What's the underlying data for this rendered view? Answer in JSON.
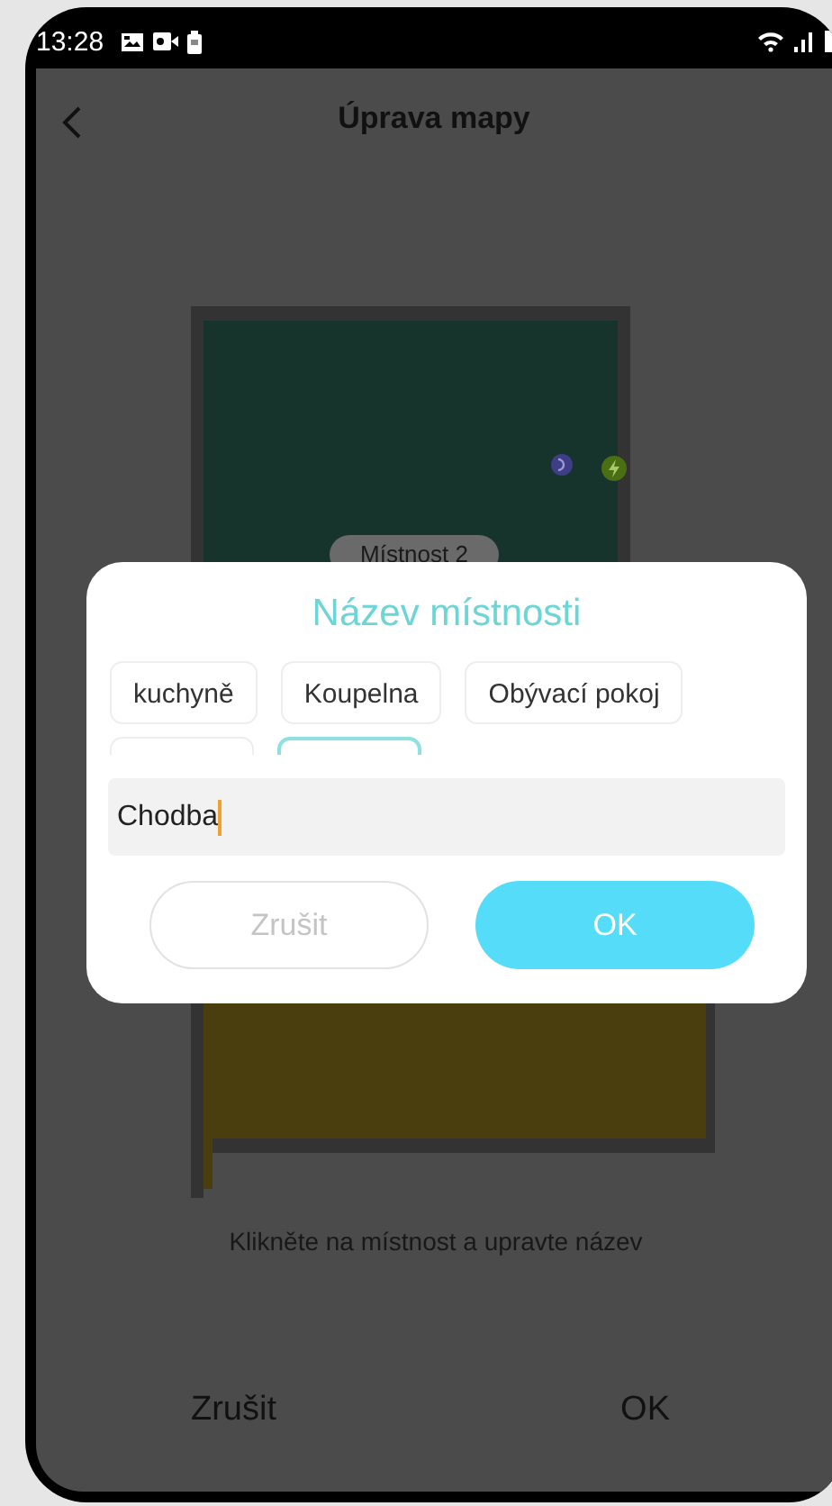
{
  "status_bar": {
    "time": "13:28"
  },
  "header": {
    "title": "Úprava mapy"
  },
  "map": {
    "room_labels": [
      {
        "label": "Místnost 2"
      }
    ]
  },
  "hint": "Klikněte na místnost a upravte název",
  "bottom_actions": [
    {
      "label": "Zrušit"
    },
    {
      "label": "OK"
    }
  ],
  "dialog": {
    "title": "Název místnosti",
    "room_chips": [
      {
        "label": "kuchyně",
        "selected": false
      },
      {
        "label": "Koupelna",
        "selected": false
      },
      {
        "label": "Obývací pokoj",
        "selected": false
      },
      {
        "selected": false
      },
      {
        "selected": true
      }
    ],
    "name_field": {
      "value": "Chodba"
    },
    "buttons": [
      {
        "label": "Zrušit",
        "kind": "cancel"
      },
      {
        "label": "OK",
        "kind": "confirm"
      }
    ]
  }
}
